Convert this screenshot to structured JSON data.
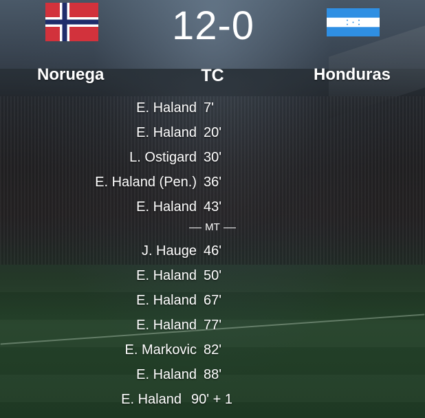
{
  "match": {
    "score": "12-0",
    "status": "TC",
    "home_team": "Noruega",
    "away_team": "Honduras",
    "home_flag": "norway-flag",
    "away_flag": "honduras-flag"
  },
  "goals_first_half": [
    {
      "scorer": "E. Haland",
      "minute": "7'"
    },
    {
      "scorer": "E. Haland",
      "minute": "20'"
    },
    {
      "scorer": "L. Ostigard",
      "minute": "30'"
    },
    {
      "scorer": "E. Haland (Pen.)",
      "minute": "36'"
    },
    {
      "scorer": "E. Haland",
      "minute": "43'"
    }
  ],
  "halftime_label": "MT",
  "goals_second_half": [
    {
      "scorer": "J. Hauge",
      "minute": "46'"
    },
    {
      "scorer": "E. Haland",
      "minute": "50'"
    },
    {
      "scorer": "E. Haland",
      "minute": "67'"
    },
    {
      "scorer": "E. Haland",
      "minute": "77'"
    },
    {
      "scorer": "E. Markovic",
      "minute": "82'"
    },
    {
      "scorer": "E. Haland",
      "minute": "88'"
    },
    {
      "scorer": "E. Haland",
      "minute": "90' + 1"
    }
  ],
  "colors": {
    "norway_red": "#d2323c",
    "norway_blue": "#1f2d6b",
    "honduras_blue": "#2f8fe3"
  }
}
